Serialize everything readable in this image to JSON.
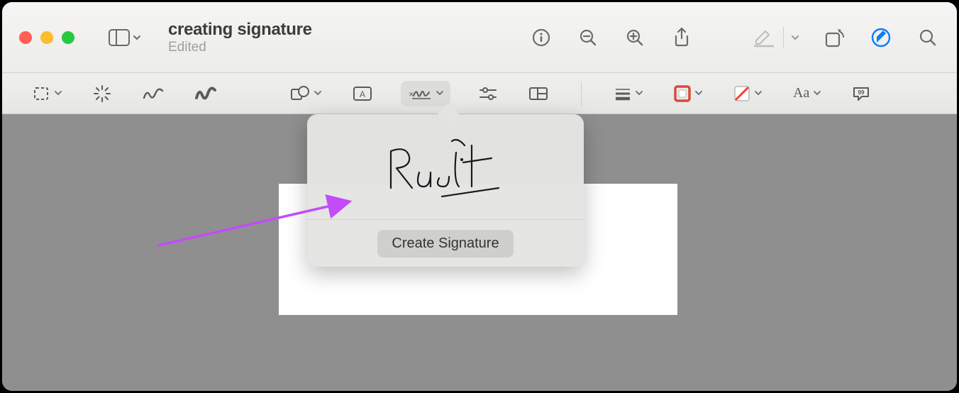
{
  "document": {
    "title": "creating signature",
    "subtitle": "Edited"
  },
  "popover": {
    "signature_name": "Rachit",
    "create_button": "Create Signature"
  },
  "markup_toolbar": {
    "text_style_label": "Aa"
  },
  "colors": {
    "accent_blue": "#0a7cff",
    "shape_border_red": "#d84a3c",
    "annotation_arrow": "#c24cf9"
  }
}
